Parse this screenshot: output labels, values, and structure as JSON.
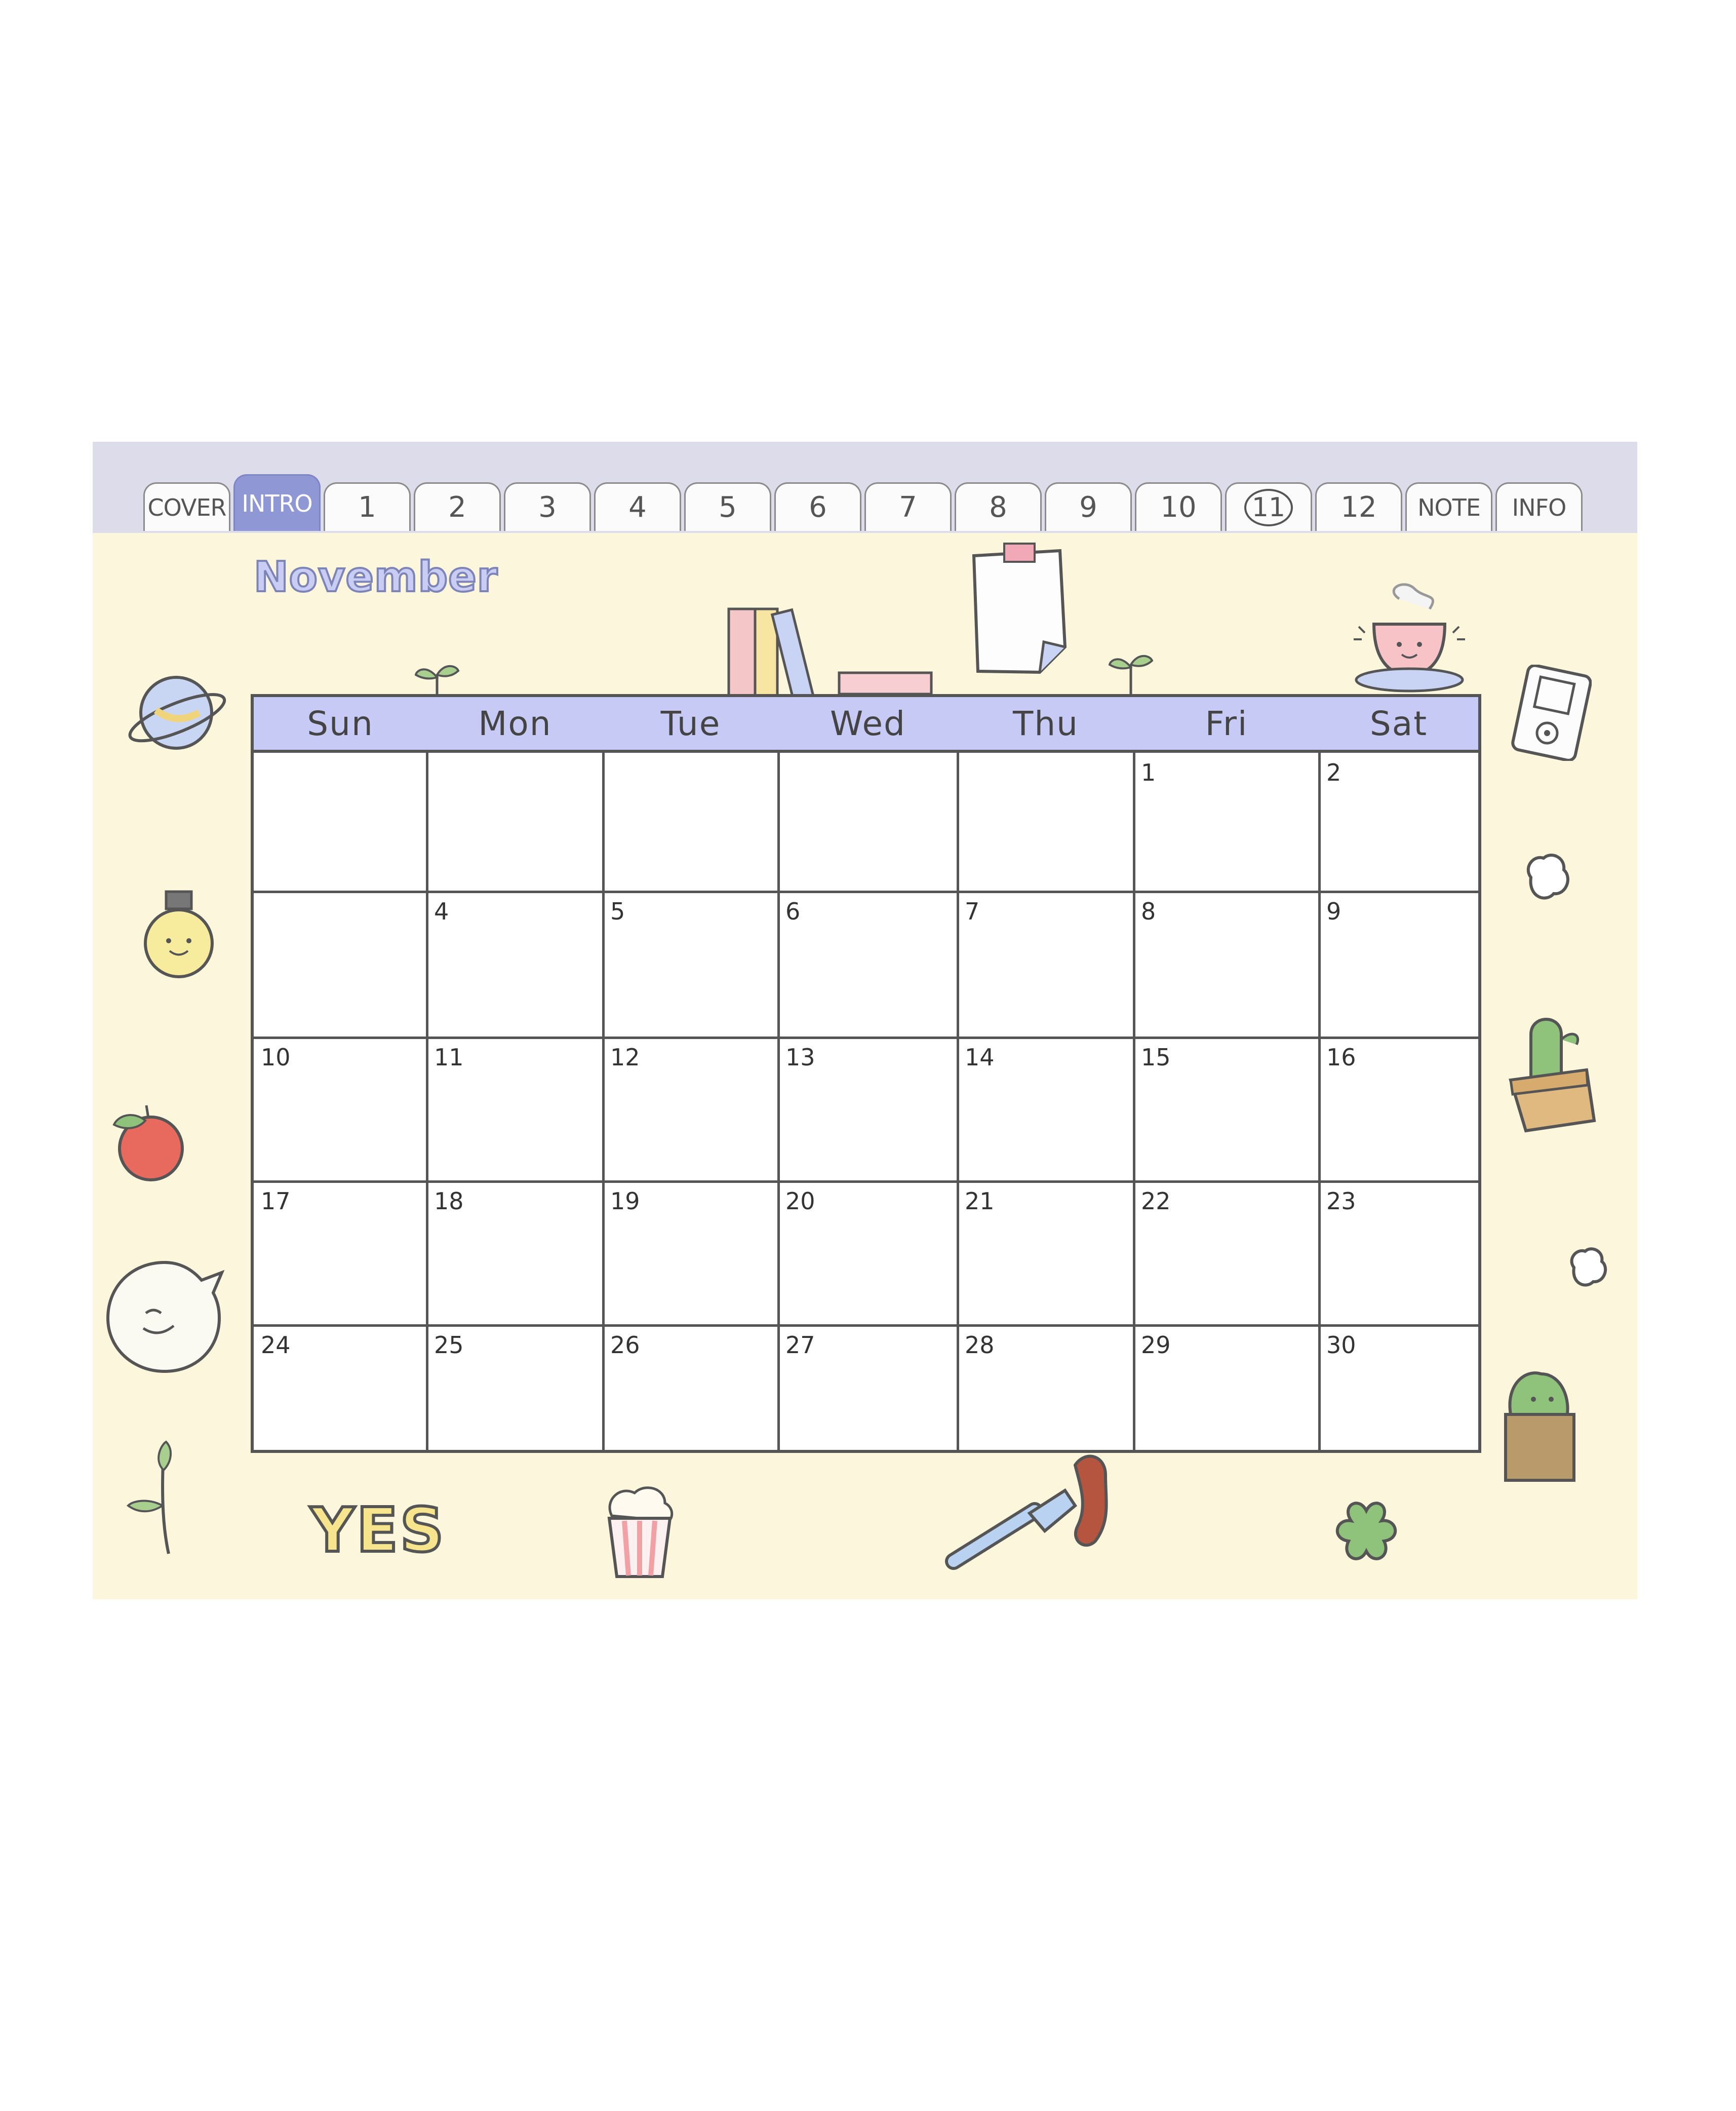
{
  "tabs": [
    {
      "label": "COVER",
      "active": false
    },
    {
      "label": "INTRO",
      "active": true
    },
    {
      "label": "1"
    },
    {
      "label": "2"
    },
    {
      "label": "3"
    },
    {
      "label": "4"
    },
    {
      "label": "5"
    },
    {
      "label": "6"
    },
    {
      "label": "7"
    },
    {
      "label": "8"
    },
    {
      "label": "9"
    },
    {
      "label": "10"
    },
    {
      "label": "11",
      "circled": true
    },
    {
      "label": "12"
    },
    {
      "label": "NOTE"
    },
    {
      "label": "INFO"
    }
  ],
  "calendar": {
    "month": "November",
    "weekdays": [
      "Sun",
      "Mon",
      "Tue",
      "Wed",
      "Thu",
      "Fri",
      "Sat"
    ],
    "weeks": [
      [
        "",
        "",
        "",
        "",
        "",
        "1",
        "2"
      ],
      [
        "",
        "4",
        "5",
        "6",
        "7",
        "8",
        "9"
      ],
      [
        "10",
        "11",
        "12",
        "13",
        "14",
        "15",
        "16"
      ],
      [
        "17",
        "18",
        "19",
        "20",
        "21",
        "22",
        "23"
      ],
      [
        "24",
        "25",
        "26",
        "27",
        "28",
        "29",
        "30"
      ]
    ]
  },
  "stickers": {
    "yes_text": "YES"
  },
  "colors": {
    "page_bg": "#fcf6dc",
    "tab_bar": "#dcdcea",
    "active_tab": "#8f98d4",
    "weekday_header": "#c6caf4"
  },
  "icons": [
    "planet-icon",
    "lightbulb-icon",
    "apple-icon",
    "speech-bubble-icon",
    "sprout-icon",
    "books-icon",
    "note-paper-icon",
    "teacup-icon",
    "music-player-icon",
    "cactus-icon",
    "popcorn-icon",
    "fork-sausage-icon",
    "clover-icon"
  ]
}
